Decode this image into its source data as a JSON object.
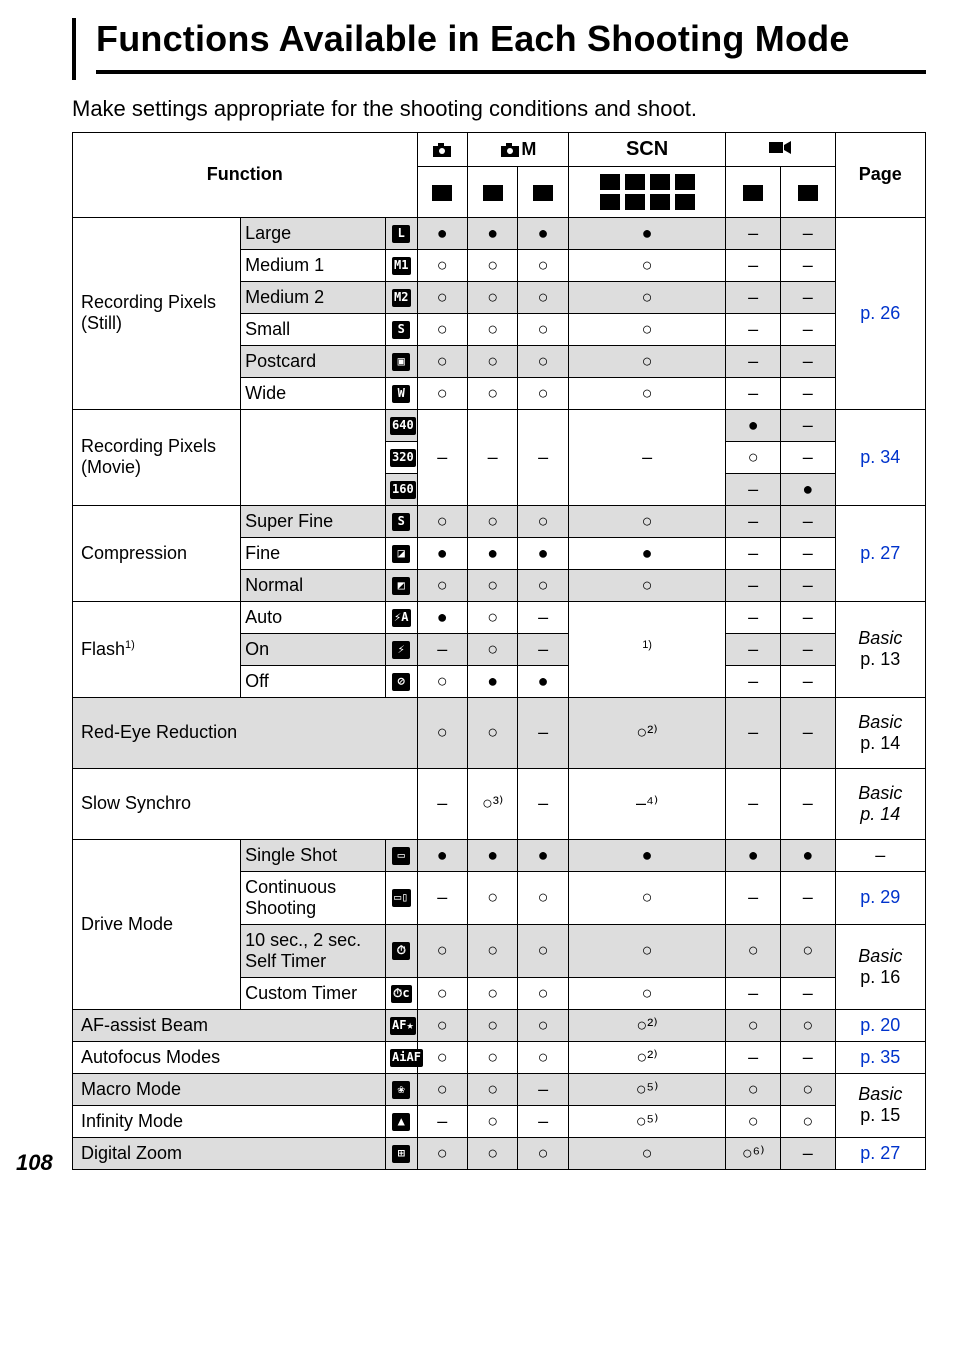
{
  "title": "Functions Available in Each Shooting Mode",
  "intro": "Make settings appropriate for the shooting conditions and shoot.",
  "header": {
    "function": "Function",
    "scn": "SCN",
    "page": "Page"
  },
  "glyph": {
    "default": "●",
    "avail": "○",
    "na": "–",
    "avail_2": "○²⁾",
    "avail_3": "○³⁾",
    "na_4": "–⁴⁾",
    "avail_5": "○⁵⁾",
    "avail_6": "○⁶⁾",
    "flash_note": "1)"
  },
  "page_number": "108",
  "groups": [
    {
      "label": "Recording Pixels (Still)",
      "page_ref": "p. 26",
      "page_class": "blue",
      "rows": [
        {
          "sub": "Large",
          "icon": "L",
          "vals": [
            "●",
            "●",
            "●",
            "●",
            "–",
            "–"
          ],
          "gray": true
        },
        {
          "sub": "Medium 1",
          "icon": "M1",
          "vals": [
            "○",
            "○",
            "○",
            "○",
            "–",
            "–"
          ]
        },
        {
          "sub": "Medium 2",
          "icon": "M2",
          "vals": [
            "○",
            "○",
            "○",
            "○",
            "–",
            "–"
          ],
          "gray": true
        },
        {
          "sub": "Small",
          "icon": "S",
          "vals": [
            "○",
            "○",
            "○",
            "○",
            "–",
            "–"
          ]
        },
        {
          "sub": "Postcard",
          "icon": "▣",
          "vals": [
            "○",
            "○",
            "○",
            "○",
            "–",
            "–"
          ],
          "gray": true
        },
        {
          "sub": "Wide",
          "icon": "W",
          "vals": [
            "○",
            "○",
            "○",
            "○",
            "–",
            "–"
          ]
        }
      ]
    },
    {
      "label": "Recording Pixels (Movie)",
      "page_ref": "p. 34",
      "page_class": "blue",
      "rows": [
        {
          "sub": "",
          "icon": "640",
          "vals": [
            "",
            "",
            "",
            "",
            "●",
            "–"
          ],
          "gray": true,
          "vspan": true
        },
        {
          "sub": "",
          "icon": "320",
          "vals": [
            "–",
            "–",
            "–",
            "–",
            "○",
            "–"
          ]
        },
        {
          "sub": "",
          "icon": "160",
          "vals": [
            "",
            "",
            "",
            "",
            "–",
            "●"
          ],
          "gray": true,
          "vspan_end": true
        }
      ]
    },
    {
      "label": "Compression",
      "page_ref": "p. 27",
      "page_class": "blue",
      "rows": [
        {
          "sub": "Super Fine",
          "icon": "S",
          "vals": [
            "○",
            "○",
            "○",
            "○",
            "–",
            "–"
          ],
          "gray": true
        },
        {
          "sub": "Fine",
          "icon": "◪",
          "vals": [
            "●",
            "●",
            "●",
            "●",
            "–",
            "–"
          ]
        },
        {
          "sub": "Normal",
          "icon": "◩",
          "vals": [
            "○",
            "○",
            "○",
            "○",
            "–",
            "–"
          ],
          "gray": true
        }
      ]
    },
    {
      "label_html": "Flash<span class='sup'>1)</span>",
      "page_ref_html": "<span class='italic'>Basic</span><br>p. 13",
      "special_scn": "1)",
      "rows": [
        {
          "sub": "Auto",
          "icon": "⚡A",
          "vals": [
            "●",
            "○",
            "–",
            "",
            "–",
            "–"
          ]
        },
        {
          "sub": "On",
          "icon": "⚡",
          "vals": [
            "–",
            "○",
            "–",
            "",
            "–",
            "–"
          ],
          "gray": true
        },
        {
          "sub": "Off",
          "icon": "⊘",
          "vals": [
            "○",
            "●",
            "●",
            "",
            "–",
            "–"
          ]
        }
      ]
    }
  ],
  "single_rows": [
    {
      "label": "Red-Eye Reduction",
      "icon": "",
      "vals": [
        "○",
        "○",
        "–",
        "○²⁾",
        "–",
        "–"
      ],
      "page_ref_html": "<span class='italic'>Basic</span><br>p. 14",
      "gray": true,
      "tall": true
    },
    {
      "label": "Slow Synchro",
      "icon": "",
      "vals": [
        "–",
        "○³⁾",
        "–",
        "–⁴⁾",
        "–",
        "–"
      ],
      "page_ref_html": "<span class='italic'>Basic<br>p. 14</span>",
      "tall": true
    }
  ],
  "drive_group": {
    "label": "Drive Mode",
    "rows": [
      {
        "sub": "Single Shot",
        "icon": "▭",
        "vals": [
          "●",
          "●",
          "●",
          "●",
          "●",
          "●"
        ],
        "gray": true,
        "page_ref": "–"
      },
      {
        "sub": "Continuous Shooting",
        "icon": "▭▯",
        "vals": [
          "–",
          "○",
          "○",
          "○",
          "–",
          "–"
        ],
        "page_ref": "p. 29",
        "page_class": "blue"
      },
      {
        "sub": "10 sec., 2 sec. Self Timer",
        "icon": "⏱",
        "vals": [
          "○",
          "○",
          "○",
          "○",
          "○",
          "○"
        ],
        "gray": true,
        "page_ref_html": "<span class='italic'>Basic</span><br>p. 16",
        "page_rowspan": 2
      },
      {
        "sub": "Custom Timer",
        "icon": "⏱c",
        "vals": [
          "○",
          "○",
          "○",
          "○",
          "–",
          "–"
        ]
      }
    ]
  },
  "tail_rows": [
    {
      "label": "AF-assist Beam",
      "icon": "AF★",
      "vals": [
        "○",
        "○",
        "○",
        "○²⁾",
        "○",
        "○"
      ],
      "page_ref": "p. 20",
      "page_class": "blue",
      "gray": true
    },
    {
      "label": "Autofocus Modes",
      "icon": "AiAF",
      "vals": [
        "○",
        "○",
        "○",
        "○²⁾",
        "–",
        "–"
      ],
      "page_ref": "p. 35",
      "page_class": "blue"
    },
    {
      "label": "Macro Mode",
      "icon": "❀",
      "vals": [
        "○",
        "○",
        "–",
        "○⁵⁾",
        "○",
        "○"
      ],
      "page_ref_html": "<span class='italic'>Basic</span>",
      "gray": true,
      "page_rowspan": 2
    },
    {
      "label": "Infinity Mode",
      "icon": "▲",
      "vals": [
        "–",
        "○",
        "–",
        "○⁵⁾",
        "○",
        "○"
      ],
      "page_ref_suffix": "p. 15"
    },
    {
      "label": "Digital Zoom",
      "icon": "⊞",
      "vals": [
        "○",
        "○",
        "○",
        "○",
        "○⁶⁾",
        "–"
      ],
      "page_ref": "p. 27",
      "page_class": "blue",
      "gray": true
    }
  ]
}
